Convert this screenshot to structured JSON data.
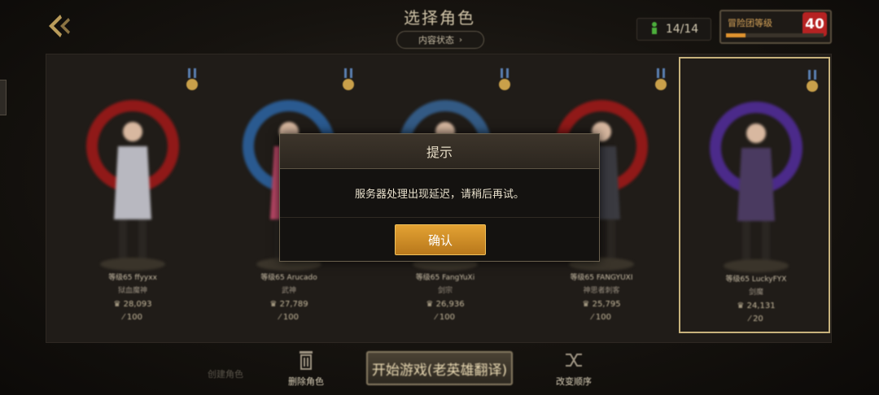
{
  "header": {
    "title": "选择角色",
    "content_status": "内容状态",
    "character_count": "14/14",
    "adventure_level_label": "冒险团等级",
    "adventure_level": "40",
    "adventure_progress": 0.2
  },
  "characters": [
    {
      "name": "等级65 ffyyxx",
      "class": "狱血魔神",
      "power": "28,093",
      "fatigue": "100"
    },
    {
      "name": "等级65 Arucado",
      "class": "武神",
      "power": "27,789",
      "fatigue": "100"
    },
    {
      "name": "等级65 FangYuXi",
      "class": "剑宗",
      "power": "26,936",
      "fatigue": "100"
    },
    {
      "name": "等级65 FANGYUXI",
      "class": "神思者刺客",
      "power": "25,795",
      "fatigue": "100"
    },
    {
      "name": "等级65 LuckyFYX",
      "class": "剑魔",
      "power": "24,131",
      "fatigue": "20"
    }
  ],
  "bottom": {
    "create_label": "创建角色",
    "delete_label": "删除角色",
    "start_label": "开始游戏(老英雄翻译)",
    "reorder_label": "改变顺序"
  },
  "dialog": {
    "title": "提示",
    "message": "服务器处理出现延迟，请稍后再试。",
    "confirm": "确认"
  },
  "colors": {
    "accent": "#d99a2b",
    "selected_border": "#c7b27c",
    "level_badge": "#b62222"
  }
}
